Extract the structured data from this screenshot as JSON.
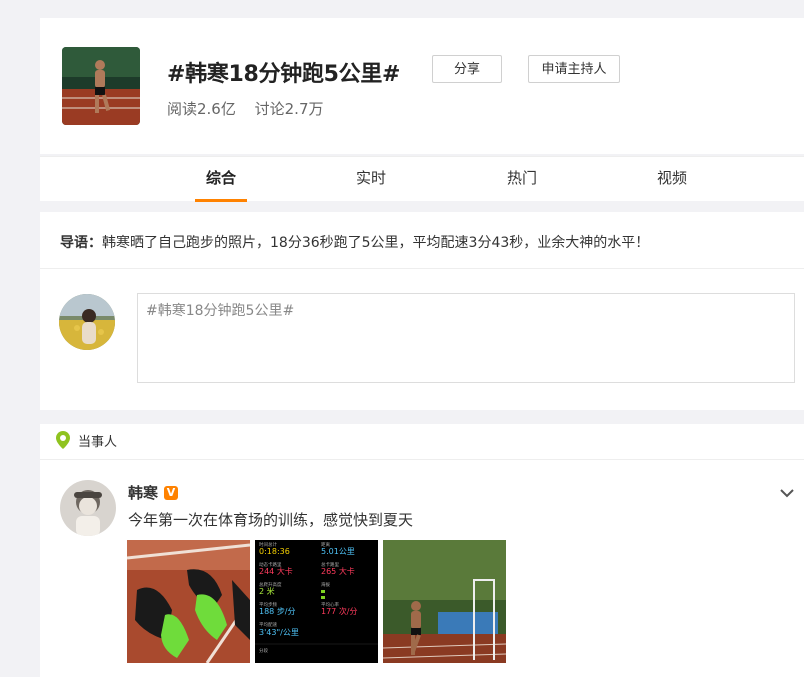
{
  "header": {
    "title": "#韩寒18分钟跑5公里#",
    "read_label": "阅读2.6亿",
    "discuss_label": "讨论2.7万",
    "share_label": "分享",
    "host_label": "申请主持人"
  },
  "tabs": [
    {
      "label": "综合",
      "active": true
    },
    {
      "label": "实时",
      "active": false
    },
    {
      "label": "热门",
      "active": false
    },
    {
      "label": "视频",
      "active": false
    }
  ],
  "guide": {
    "prefix": "导语：",
    "text": "韩寒晒了自己跑步的照片，18分36秒跑了5公里，平均配速3分43秒，业余大神的水平！"
  },
  "composer": {
    "value": "#韩寒18分钟跑5公里#"
  },
  "feed": {
    "section_label": "当事人",
    "user_name": "韩寒",
    "verified_badge": "V",
    "post_text": "今年第一次在体育场的训练，感觉快到夏天",
    "photos": [
      "running-shoes-photo",
      "workout-stats-screenshot",
      "track-running-photo"
    ]
  },
  "workout": {
    "time": "0:18:36",
    "distance": "5.01公里",
    "active_cal": "244 大卡",
    "total_cal": "265 大卡",
    "elevation": "2 米",
    "cadence": "188 步/分",
    "heart_rate": "177 次/分",
    "pace": "3'43\"/公里"
  },
  "colors": {
    "accent": "#ff8200",
    "background": "#f2f2f5"
  }
}
